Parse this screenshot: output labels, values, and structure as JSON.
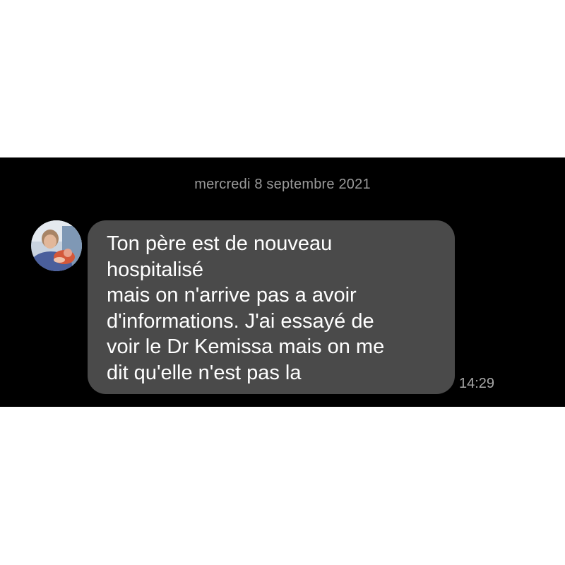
{
  "conversation": {
    "date_divider": "mercredi 8 septembre 2021",
    "messages": [
      {
        "direction": "incoming",
        "avatar": "contact-photo",
        "lines": [
          "Ton père est de nouveau",
          "hospitalisé",
          "mais on n'arrive pas a avoir",
          "d'informations. J'ai essayé de",
          "voir le Dr Kemissa mais on me",
          "dit qu'elle n'est pas la"
        ],
        "time": "14:29"
      }
    ]
  },
  "colors": {
    "page_background": "#ffffff",
    "chat_background": "#000000",
    "bubble_incoming": "#4a4a4a",
    "message_text": "#ffffff",
    "meta_text": "#9a9a9a"
  }
}
